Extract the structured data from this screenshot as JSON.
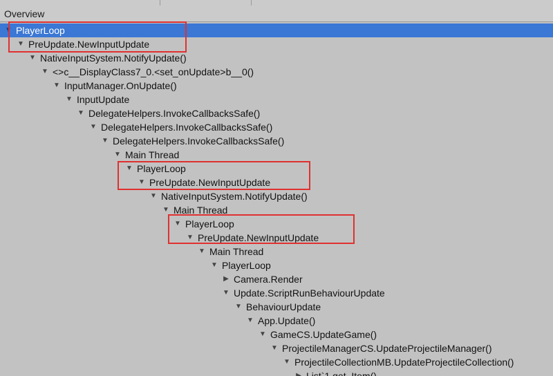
{
  "header": {
    "title": "Overview"
  },
  "tree": {
    "rows": [
      {
        "label": "PlayerLoop",
        "expanded": true,
        "selected": true
      },
      {
        "label": "PreUpdate.NewInputUpdate",
        "expanded": true
      },
      {
        "label": "NativeInputSystem.NotifyUpdate()",
        "expanded": true
      },
      {
        "label": "<>c__DisplayClass7_0.<set_onUpdate>b__0()",
        "expanded": true
      },
      {
        "label": "InputManager.OnUpdate()",
        "expanded": true
      },
      {
        "label": "InputUpdate",
        "expanded": true
      },
      {
        "label": "DelegateHelpers.InvokeCallbacksSafe()",
        "expanded": true
      },
      {
        "label": "DelegateHelpers.InvokeCallbacksSafe()",
        "expanded": true
      },
      {
        "label": "DelegateHelpers.InvokeCallbacksSafe()",
        "expanded": true
      },
      {
        "label": "Main Thread",
        "expanded": true
      },
      {
        "label": "PlayerLoop",
        "expanded": true
      },
      {
        "label": "PreUpdate.NewInputUpdate",
        "expanded": true
      },
      {
        "label": "NativeInputSystem.NotifyUpdate()",
        "expanded": true
      },
      {
        "label": "Main Thread",
        "expanded": true
      },
      {
        "label": "PlayerLoop",
        "expanded": true
      },
      {
        "label": "PreUpdate.NewInputUpdate",
        "expanded": true
      },
      {
        "label": "Main Thread",
        "expanded": true
      },
      {
        "label": "PlayerLoop",
        "expanded": true
      },
      {
        "label": "Camera.Render",
        "expanded": false
      },
      {
        "label": "Update.ScriptRunBehaviourUpdate",
        "expanded": true
      },
      {
        "label": "BehaviourUpdate",
        "expanded": true
      },
      {
        "label": "App.Update()",
        "expanded": true
      },
      {
        "label": "GameCS.UpdateGame()",
        "expanded": true
      },
      {
        "label": "ProjectileManagerCS.UpdateProjectileManager()",
        "expanded": true
      },
      {
        "label": "ProjectileCollectionMB.UpdateProjectileCollection()",
        "expanded": true
      },
      {
        "label": "List`1.get_Item()",
        "expanded": false
      }
    ]
  },
  "colors": {
    "selection": "#3b77d4",
    "highlight_box": "#e03030",
    "background": "#c2c2c2"
  }
}
